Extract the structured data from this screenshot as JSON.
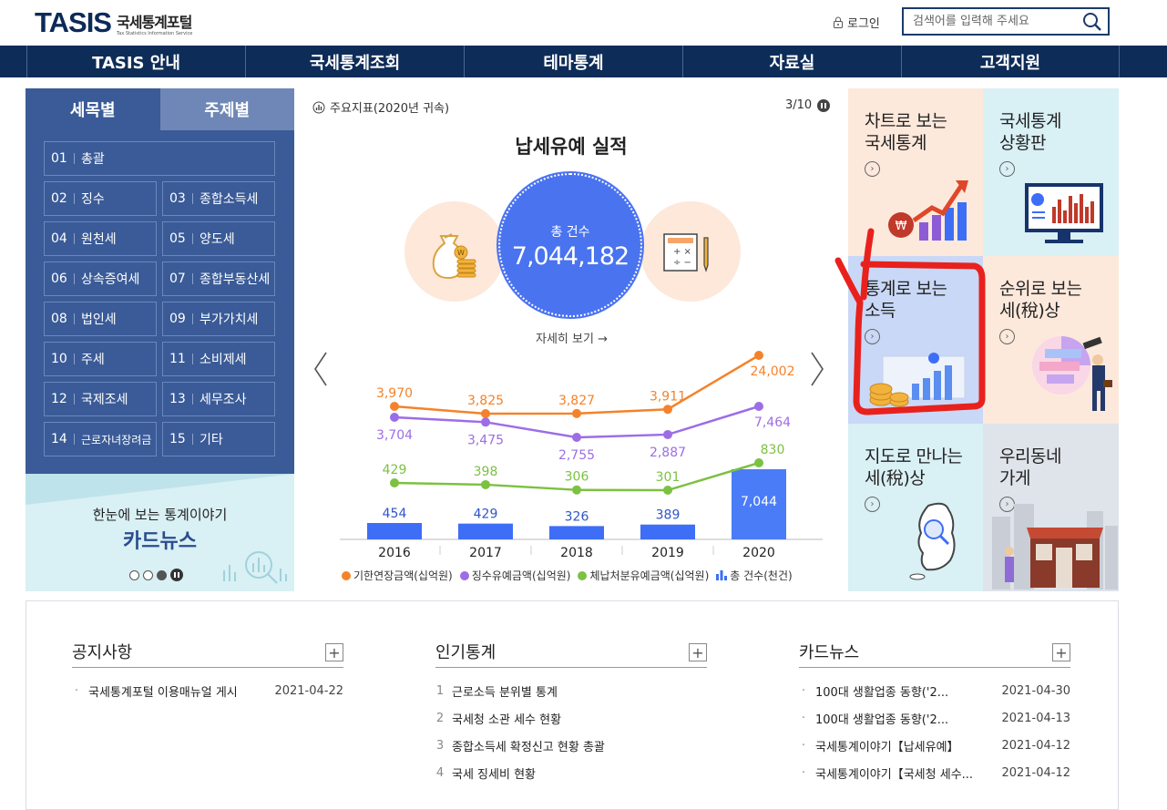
{
  "header": {
    "logo_brand": "TASIS",
    "logo_ko": "국세통계포털",
    "logo_en": "Tax Statistics Information Service",
    "login": "로그인",
    "search_placeholder": "검색어를 입력해 주세요"
  },
  "nav": [
    "TASIS 안내",
    "국세통계조회",
    "테마통계",
    "자료실",
    "고객지원"
  ],
  "tabs": {
    "active": "세목별",
    "inactive": "주제별"
  },
  "categories": [
    {
      "num": "01",
      "label": "총괄"
    },
    {
      "num": "02",
      "label": "징수"
    },
    {
      "num": "03",
      "label": "종합소득세"
    },
    {
      "num": "04",
      "label": "원천세"
    },
    {
      "num": "05",
      "label": "양도세"
    },
    {
      "num": "06",
      "label": "상속증여세"
    },
    {
      "num": "07",
      "label": "종합부동산세"
    },
    {
      "num": "08",
      "label": "법인세"
    },
    {
      "num": "09",
      "label": "부가가치세"
    },
    {
      "num": "10",
      "label": "주세"
    },
    {
      "num": "11",
      "label": "소비제세"
    },
    {
      "num": "12",
      "label": "국제조세"
    },
    {
      "num": "13",
      "label": "세무조사"
    },
    {
      "num": "14",
      "label": "근로자녀장려금"
    },
    {
      "num": "15",
      "label": "기타"
    }
  ],
  "cardnews_promo": {
    "sub": "한눈에 보는 통계이야기",
    "main": "카드뉴스"
  },
  "indicator": {
    "label": "주요지표(2020년 귀속)",
    "page": "3/10"
  },
  "main_circle": {
    "label": "총 건수",
    "value": "7,044,182"
  },
  "detail_link": "자세히 보기",
  "chart_data": {
    "type": "line",
    "title": "납세유예 실적",
    "categories": [
      "2016",
      "2017",
      "2018",
      "2019",
      "2020"
    ],
    "series": [
      {
        "name": "기한연장금액(십억원)",
        "type": "line",
        "color": "#f5822a",
        "values": [
          3970,
          3825,
          3827,
          3911,
          24002
        ],
        "labels": [
          "3,970",
          "3,825",
          "3,827",
          "3,911",
          "24,002"
        ]
      },
      {
        "name": "징수유예금액(십억원)",
        "type": "line",
        "color": "#9d6de6",
        "values": [
          3704,
          3475,
          2755,
          2887,
          7464
        ],
        "labels": [
          "3,704",
          "3,475",
          "2,755",
          "2,887",
          "7,464"
        ]
      },
      {
        "name": "체납처분유예금액(십억원)",
        "type": "line",
        "color": "#7cc142",
        "values": [
          429,
          398,
          306,
          301,
          830
        ],
        "labels": [
          "429",
          "398",
          "306",
          "301",
          "830"
        ]
      },
      {
        "name": "총 건수(천건)",
        "type": "bar",
        "color": "#3e6ef5",
        "values": [
          454,
          429,
          326,
          389,
          7044
        ],
        "labels": [
          "454",
          "429",
          "326",
          "389",
          "7,044"
        ]
      }
    ]
  },
  "tiles": [
    {
      "title": "차트로 보는\n국세통계",
      "bg": "#fde9dc"
    },
    {
      "title": "국세통계\n상황판",
      "bg": "#d9f0f5"
    },
    {
      "title": "통계로 보는\n소득",
      "bg": "#c9d8f7"
    },
    {
      "title": "순위로 보는\n세(稅)상",
      "bg": "#fde9dc"
    },
    {
      "title": "지도로 만나는\n세(稅)상",
      "bg": "#d9f0f5"
    },
    {
      "title": "우리동네\n가게",
      "bg": "#dfe3ea"
    }
  ],
  "notice": {
    "title": "공지사항",
    "items": [
      {
        "text": "국세통계포털 이용매뉴얼 게시",
        "date": "2021-04-22"
      }
    ]
  },
  "popular": {
    "title": "인기통계",
    "items": [
      {
        "num": "1",
        "text": "근로소득 분위별 통계"
      },
      {
        "num": "2",
        "text": "국세청 소관 세수 현황"
      },
      {
        "num": "3",
        "text": "종합소득세 확정신고 현황 총괄"
      },
      {
        "num": "4",
        "text": "국세 징세비 현황"
      }
    ]
  },
  "cardnews": {
    "title": "카드뉴스",
    "items": [
      {
        "text": "100대 생활업종 동향('2...",
        "date": "2021-04-30"
      },
      {
        "text": "100대 생활업종 동향('2...",
        "date": "2021-04-13"
      },
      {
        "text": "국세통계이야기【납세유예】",
        "date": "2021-04-12"
      },
      {
        "text": "국세통계이야기【국세청 세수...",
        "date": "2021-04-12"
      }
    ]
  },
  "colors": {
    "navy": "#0e2c58",
    "tab_blue": "#3a5b97",
    "accent_blue": "#4a73f0",
    "annotation_red": "#e8211d"
  }
}
